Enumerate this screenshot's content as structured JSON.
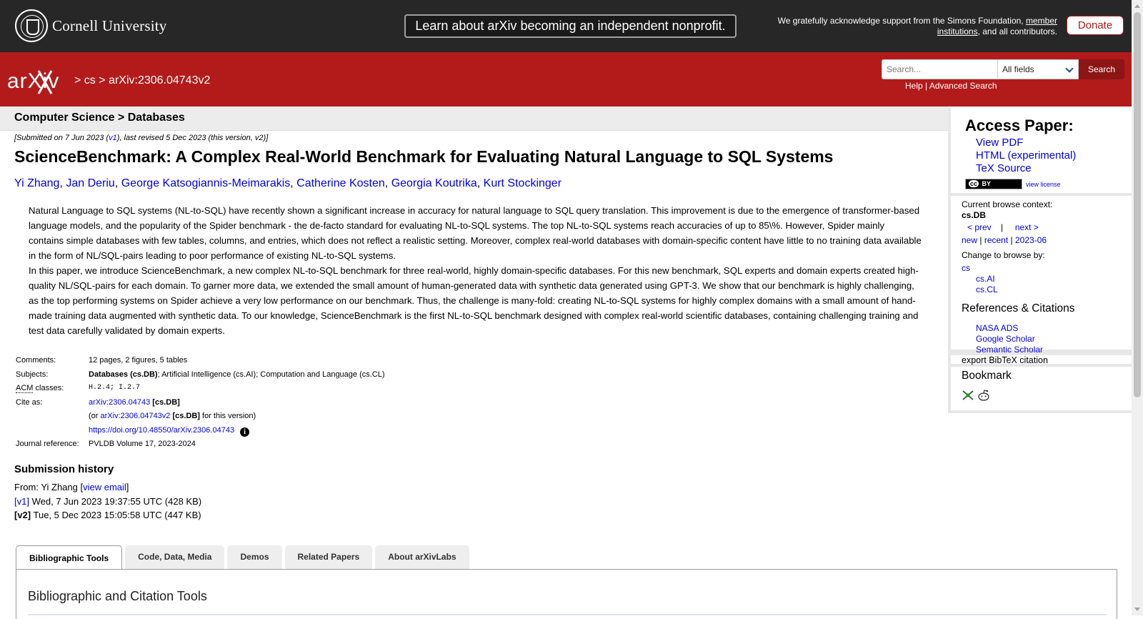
{
  "banner": {
    "university": "Cornell University",
    "announcement": "Learn about arXiv becoming an independent nonprofit.",
    "support_text_1": "We gratefully acknowledge support from the Simons Foundation,",
    "support_link": "member institutions",
    "support_text_2": ", and all contributors.",
    "donate_label": "Donate"
  },
  "header": {
    "logo_text": "arXiv",
    "crumb_sep1": ">",
    "crumb_cs": "cs",
    "crumb_sep2": ">",
    "crumb_id": "arXiv:2306.04743v2",
    "search_placeholder": "Search...",
    "search_field": "All fields",
    "search_button": "Search",
    "help": "Help",
    "link_sep": "|",
    "advanced": "Advanced Search"
  },
  "paper": {
    "subject_header": "Computer Science > Databases",
    "submitted_pre": "[Submitted on 7 Jun 2023 (",
    "submitted_v1": "v1",
    "submitted_post": "), last revised 5 Dec 2023 (this version, v2)]",
    "title": "ScienceBenchmark: A Complex Real-World Benchmark for Evaluating Natural Language to SQL Systems",
    "authors": [
      "Yi Zhang",
      "Jan Deriu",
      "George Katsogiannis-Meimarakis",
      "Catherine Kosten",
      "Georgia Koutrika",
      "Kurt Stockinger"
    ],
    "abstract_p1": "Natural Language to SQL systems (NL-to-SQL) have recently shown a significant increase in accuracy for natural language to SQL query translation. This improvement is due to the emergence of transformer-based language models, and the popularity of the Spider benchmark - the de-facto standard for evaluating NL-to-SQL systems. The top NL-to-SQL systems reach accuracies of up to 85\\%. However, Spider mainly contains simple databases with few tables, columns, and entries, which does not reflect a realistic setting. Moreover, complex real-world databases with domain-specific content have little to no training data available in the form of NL/SQL-pairs leading to poor performance of existing NL-to-SQL systems.",
    "abstract_p2": "In this paper, we introduce ScienceBenchmark, a new complex NL-to-SQL benchmark for three real-world, highly domain-specific databases. For this new benchmark, SQL experts and domain experts created high-quality NL/SQL-pairs for each domain. To garner more data, we extended the small amount of human-generated data with synthetic data generated using GPT-3. We show that our benchmark is highly challenging, as the top performing systems on Spider achieve a very low performance on our benchmark. Thus, the challenge is many-fold: creating NL-to-SQL systems for highly complex domains with a small amount of hand-made training data augmented with synthetic data. To our knowledge, ScienceBenchmark is the first NL-to-SQL benchmark designed with complex real-world scientific databases, containing challenging training and test data carefully validated by domain experts."
  },
  "meta": {
    "comments_label": "Comments:",
    "comments": "12 pages, 2 figures, 5 tables",
    "subjects_label": "Subjects:",
    "subjects_primary": "Databases (cs.DB)",
    "subjects_rest": "; Artificial Intelligence (cs.AI); Computation and Language (cs.CL)",
    "acm_abbr": "ACM",
    "acm_label_rest": " classes:",
    "acm": "H.2.4; I.2.7",
    "cite_label": "Cite as:",
    "cite_id": "arXiv:2306.04743",
    "cite_cat": "[cs.DB]",
    "cite_or": "(or",
    "cite_v_id": "arXiv:2306.04743v2",
    "cite_v_cat": "[cs.DB]",
    "cite_v_post": "for this version)",
    "doi": "https://doi.org/10.48550/arXiv.2306.04743",
    "info_glyph": "i",
    "journal_label": "Journal reference:",
    "journal": "PVLDB Volume 17, 2023-2024"
  },
  "history": {
    "title": "Submission history",
    "from_pre": "From: Yi Zhang [",
    "view_email": "view email",
    "from_post": "]",
    "v1_label": "[v1]",
    "v1_text": " Wed, 7 Jun 2023 19:37:55 UTC (428 KB)",
    "v2_label": "[v2]",
    "v2_text": " Tue, 5 Dec 2023 15:05:58 UTC (447 KB)"
  },
  "tabs": [
    "Bibliographic Tools",
    "Code, Data, Media",
    "Demos",
    "Related Papers",
    "About arXivLabs"
  ],
  "panel_title": "Bibliographic and Citation Tools",
  "sidebar": {
    "access_title": "Access Paper:",
    "view_pdf": "View PDF",
    "html": "HTML (experimental)",
    "tex": "TeX Source",
    "cc_label": "BY",
    "view_license": "view license",
    "context_label": "Current browse context:",
    "context_value": "cs.DB",
    "prev": "< prev",
    "pipe": "|",
    "next": "next >",
    "new": "new",
    "recent": "recent",
    "month": "2023-06",
    "change_label": "Change to browse by:",
    "browse_cs": "cs",
    "browse_ai": "cs.AI",
    "browse_cl": "cs.CL",
    "refs_title": "References & Citations",
    "nasa": "NASA ADS",
    "scholar": "Google Scholar",
    "semantic": "Semantic Scholar",
    "export": "export BibTeX citation",
    "bookmark_title": "Bookmark"
  },
  "colors": {
    "brand_red": "#b31b1b",
    "banner": "#272727",
    "link": "#0000ee"
  }
}
